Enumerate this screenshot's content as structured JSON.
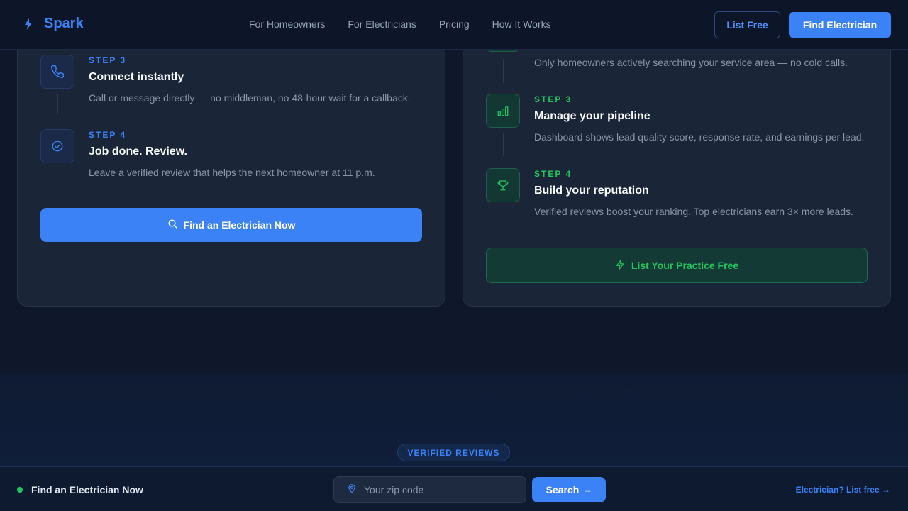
{
  "nav": {
    "brand": "Spark",
    "links": [
      "For Homeowners",
      "For Electricians",
      "Pricing",
      "How It Works"
    ],
    "list_free": "List Free",
    "find_electrician": "Find Electrician"
  },
  "homeowners": {
    "steps": [
      {
        "label": "STEP 3",
        "title": "Connect instantly",
        "desc": "Call or message directly — no middleman, no 48-hour wait for a callback.",
        "icon": "phone-icon"
      },
      {
        "label": "STEP 4",
        "title": "Job done. Review.",
        "desc": "Leave a verified review that helps the next homeowner at 11 p.m.",
        "icon": "check-circle-icon"
      }
    ],
    "cta": "Find an Electrician Now"
  },
  "electricians": {
    "partial_desc": "Only homeowners actively searching your service area — no cold calls.",
    "steps": [
      {
        "label": "STEP 3",
        "title": "Manage your pipeline",
        "desc": "Dashboard shows lead quality score, response rate, and earnings per lead.",
        "icon": "bar-chart-icon"
      },
      {
        "label": "STEP 4",
        "title": "Build your reputation",
        "desc": "Verified reviews boost your ranking. Top electricians earn 3× more leads.",
        "icon": "trophy-icon"
      }
    ],
    "cta": "List Your Practice Free"
  },
  "reviews": {
    "badge": "VERIFIED REVIEWS"
  },
  "sticky": {
    "title": "Find an Electrician Now",
    "zip_placeholder": "Your zip code",
    "search_label": "Search",
    "search_arrow": "→",
    "link": "Electrician? List free →"
  },
  "colors": {
    "accent_blue": "#3b82f6",
    "accent_green": "#22c55e",
    "background": "#0f172a",
    "card": "#1b2538"
  }
}
